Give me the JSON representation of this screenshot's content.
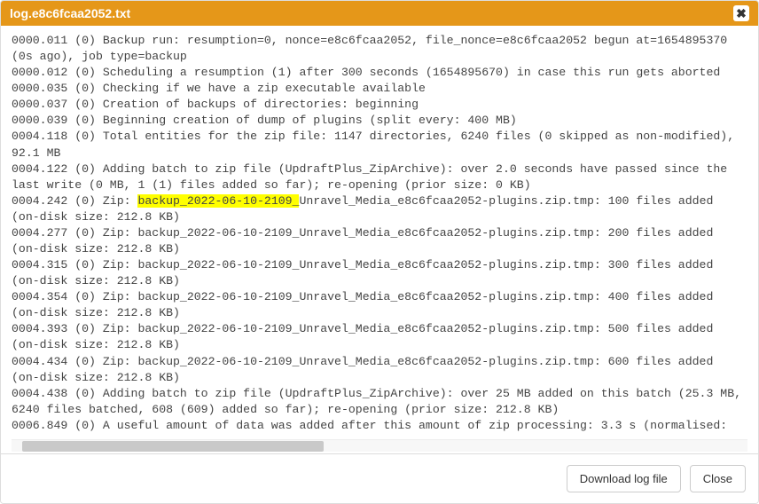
{
  "header": {
    "title": "log.e8c6fcaa2052.txt",
    "close_glyph": "✖"
  },
  "footer": {
    "download_label": "Download log file",
    "close_label": "Close"
  },
  "highlight": {
    "text": "backup_2022-06-10-2109_"
  },
  "log": {
    "lines": [
      "0000.011 (0) Backup run: resumption=0, nonce=e8c6fcaa2052, file_nonce=e8c6fcaa2052 begun at=1654895370 (0s ago), job type=backup",
      "0000.012 (0) Scheduling a resumption (1) after 300 seconds (1654895670) in case this run gets aborted",
      "0000.035 (0) Checking if we have a zip executable available",
      "0000.037 (0) Creation of backups of directories: beginning",
      "0000.039 (0) Beginning creation of dump of plugins (split every: 400 MB)",
      "0004.118 (0) Total entities for the zip file: 1147 directories, 6240 files (0 skipped as non-modified), 92.1 MB",
      "0004.122 (0) Adding batch to zip file (UpdraftPlus_ZipArchive): over 2.0 seconds have passed since the last write (0 MB, 1 (1) files added so far); re-opening (prior size: 0 KB)",
      "0004.242 (0) Zip: backup_2022-06-10-2109_Unravel_Media_e8c6fcaa2052-plugins.zip.tmp: 100 files added (on-disk size: 212.8 KB)",
      "0004.277 (0) Zip: backup_2022-06-10-2109_Unravel_Media_e8c6fcaa2052-plugins.zip.tmp: 200 files added (on-disk size: 212.8 KB)",
      "0004.315 (0) Zip: backup_2022-06-10-2109_Unravel_Media_e8c6fcaa2052-plugins.zip.tmp: 300 files added (on-disk size: 212.8 KB)",
      "0004.354 (0) Zip: backup_2022-06-10-2109_Unravel_Media_e8c6fcaa2052-plugins.zip.tmp: 400 files added (on-disk size: 212.8 KB)",
      "0004.393 (0) Zip: backup_2022-06-10-2109_Unravel_Media_e8c6fcaa2052-plugins.zip.tmp: 500 files added (on-disk size: 212.8 KB)",
      "0004.434 (0) Zip: backup_2022-06-10-2109_Unravel_Media_e8c6fcaa2052-plugins.zip.tmp: 600 files added (on-disk size: 212.8 KB)",
      "0004.438 (0) Adding batch to zip file (UpdraftPlus_ZipArchive): over 25 MB added on this batch (25.3 MB, 6240 files batched, 608 (609) added so far); re-opening (prior size: 212.8 KB)",
      "0006.849 (0) A useful amount of data was added after this amount of zip processing: 3.3 s (normalised:"
    ]
  }
}
